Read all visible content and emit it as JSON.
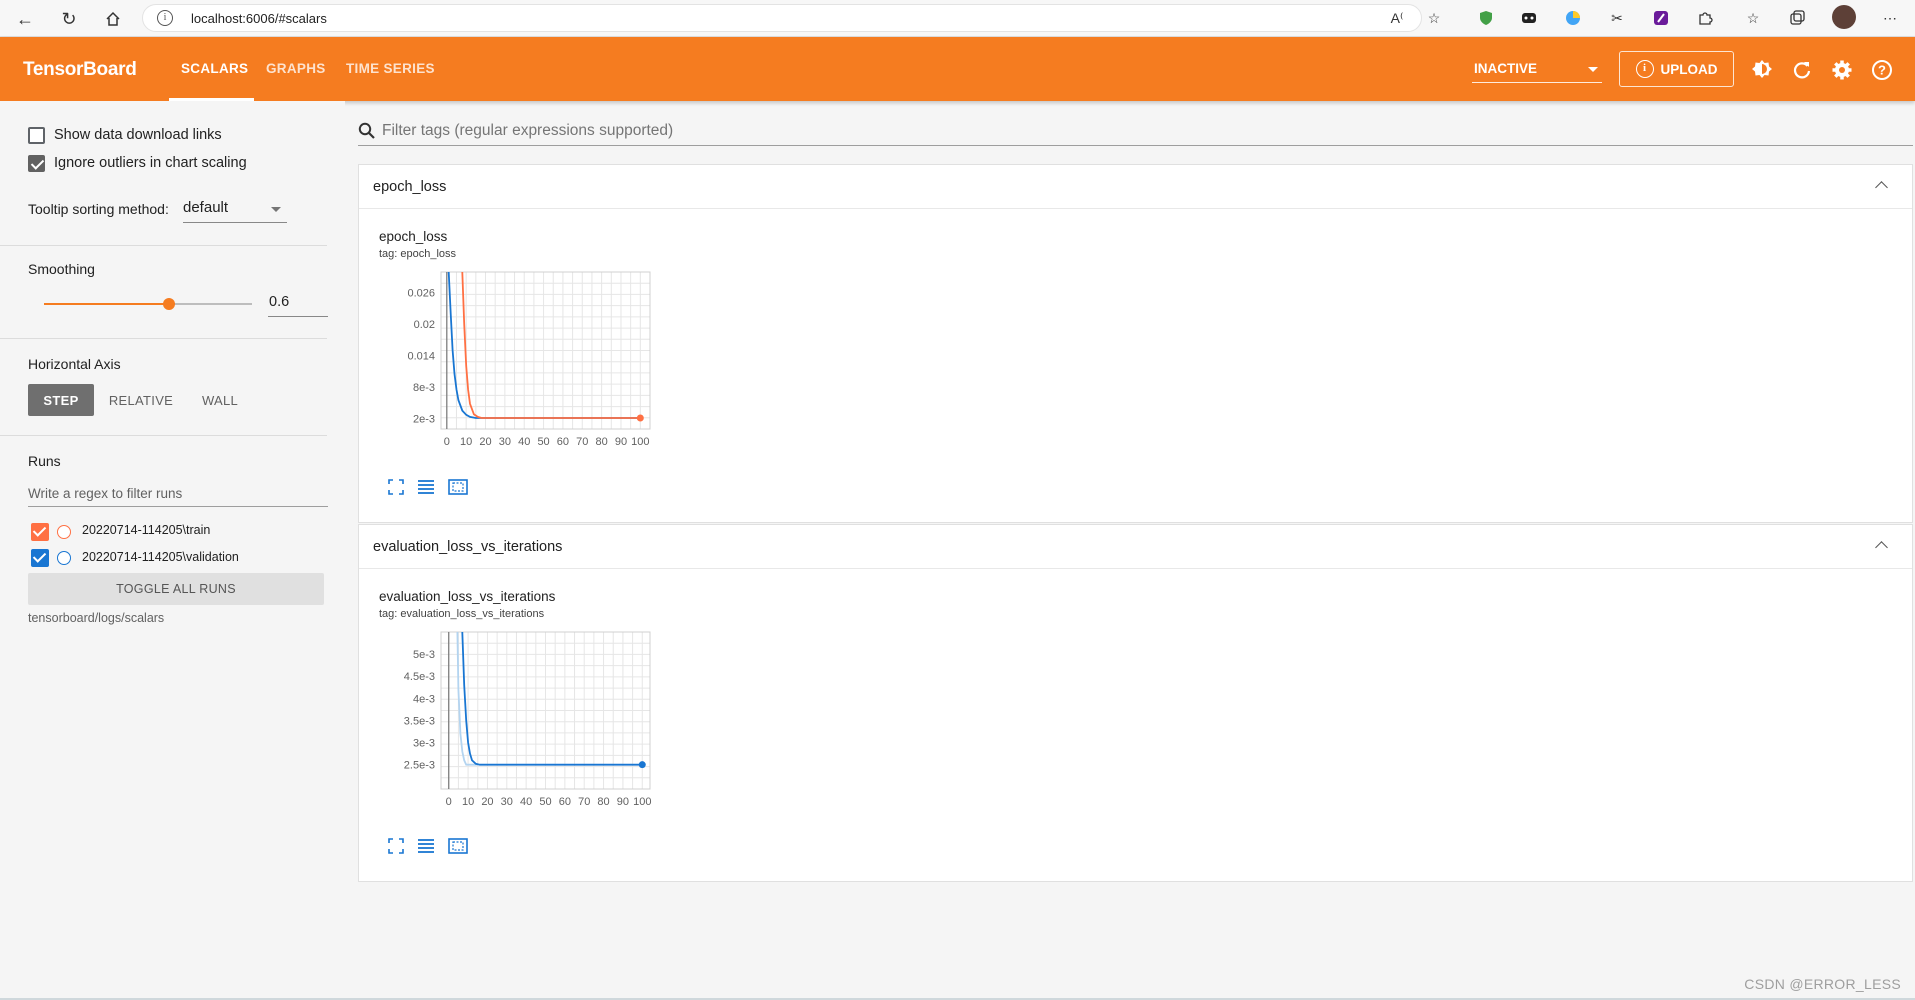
{
  "browser": {
    "url": "localhost:6006/#scalars",
    "info_icon": "info-icon"
  },
  "header": {
    "logo": "TensorBoard",
    "tabs": [
      {
        "label": "SCALARS",
        "active": true
      },
      {
        "label": "GRAPHS",
        "active": false
      },
      {
        "label": "TIME SERIES",
        "active": false
      }
    ],
    "run_state": "INACTIVE",
    "upload_label": "UPLOAD",
    "accent": "#f57c20"
  },
  "sidebar": {
    "show_download_links": {
      "label": "Show data download links",
      "checked": false
    },
    "ignore_outliers": {
      "label": "Ignore outliers in chart scaling",
      "checked": true
    },
    "tooltip_label": "Tooltip sorting method:",
    "tooltip_value": "default",
    "smoothing_label": "Smoothing",
    "smoothing_value": "0.6",
    "smoothing_fraction": 0.6,
    "horizontal_axis_label": "Horizontal Axis",
    "axis_options": [
      {
        "label": "STEP",
        "active": true
      },
      {
        "label": "RELATIVE",
        "active": false
      },
      {
        "label": "WALL",
        "active": false
      }
    ],
    "runs_label": "Runs",
    "runs_filter_placeholder": "Write a regex to filter runs",
    "runs": [
      {
        "name": "20220714-114205\\train",
        "color": "#ff7043",
        "checked": true
      },
      {
        "name": "20220714-114205\\validation",
        "color": "#1976d2",
        "checked": true
      }
    ],
    "toggle_all_label": "TOGGLE ALL RUNS",
    "logdir": "tensorboard/logs/scalars"
  },
  "main": {
    "filter_placeholder": "Filter tags (regular expressions supported)",
    "cards": [
      {
        "header": "epoch_loss",
        "chart_title": "epoch_loss",
        "chart_tag": "tag: epoch_loss"
      },
      {
        "header": "evaluation_loss_vs_iterations",
        "chart_title": "evaluation_loss_vs_iterations",
        "chart_tag": "tag: evaluation_loss_vs_iterations"
      }
    ]
  },
  "chart_data": [
    {
      "type": "line",
      "title": "epoch_loss",
      "xlabel": "",
      "ylabel": "",
      "x_ticks": [
        "0",
        "10",
        "20",
        "30",
        "40",
        "50",
        "60",
        "70",
        "80",
        "90",
        "100"
      ],
      "y_ticks": [
        "2e-3",
        "8e-3",
        "0.014",
        "0.02",
        "0.026"
      ],
      "xlim": [
        -3,
        105
      ],
      "ylim": [
        0,
        0.0299
      ],
      "grid": true,
      "series": [
        {
          "name": "20220714-114205\\train",
          "color": "#ff7043",
          "x": [
            8,
            9,
            10,
            11,
            12,
            14,
            16,
            18,
            20,
            30,
            50,
            70,
            100
          ],
          "y": [
            0.0299,
            0.02,
            0.012,
            0.0075,
            0.0048,
            0.0028,
            0.0023,
            0.0021,
            0.0021,
            0.0021,
            0.0021,
            0.0021,
            0.0021
          ]
        },
        {
          "name": "20220714-114205\\validation",
          "color": "#1976d2",
          "x": [
            1,
            2,
            3,
            4,
            5,
            6,
            8,
            10,
            12,
            15,
            20,
            50,
            100
          ],
          "y": [
            0.0299,
            0.022,
            0.015,
            0.0105,
            0.0075,
            0.0055,
            0.0035,
            0.0027,
            0.0023,
            0.0021,
            0.0021,
            0.0021,
            0.0021
          ]
        }
      ]
    },
    {
      "type": "line",
      "title": "evaluation_loss_vs_iterations",
      "xlabel": "",
      "ylabel": "",
      "x_ticks": [
        "0",
        "10",
        "20",
        "30",
        "40",
        "50",
        "60",
        "70",
        "80",
        "90",
        "100"
      ],
      "y_ticks": [
        "2.5e-3",
        "3e-3",
        "3.5e-3",
        "4e-3",
        "4.5e-3",
        "5e-3"
      ],
      "xlim": [
        -4,
        104
      ],
      "ylim": [
        0.00195,
        0.0055
      ],
      "grid": true,
      "series": [
        {
          "name": "20220714-114205\\validation",
          "color": "#1976d2",
          "x": [
            7,
            8,
            9,
            10,
            11,
            12,
            14,
            16,
            20,
            30,
            50,
            100
          ],
          "y": [
            0.0055,
            0.0043,
            0.0035,
            0.003,
            0.00275,
            0.0026,
            0.00252,
            0.0025,
            0.0025,
            0.0025,
            0.0025,
            0.0025
          ]
        },
        {
          "name": "20220714-114205\\validation (raw)",
          "color": "#b3d4f0",
          "x": [
            4.5,
            5,
            6,
            7,
            8,
            9,
            10,
            12,
            15
          ],
          "y": [
            0.0055,
            0.0042,
            0.0032,
            0.0028,
            0.0026,
            0.0025,
            0.0025,
            0.0025,
            0.0025
          ]
        }
      ]
    }
  ],
  "watermark": "CSDN @ERROR_LESS"
}
